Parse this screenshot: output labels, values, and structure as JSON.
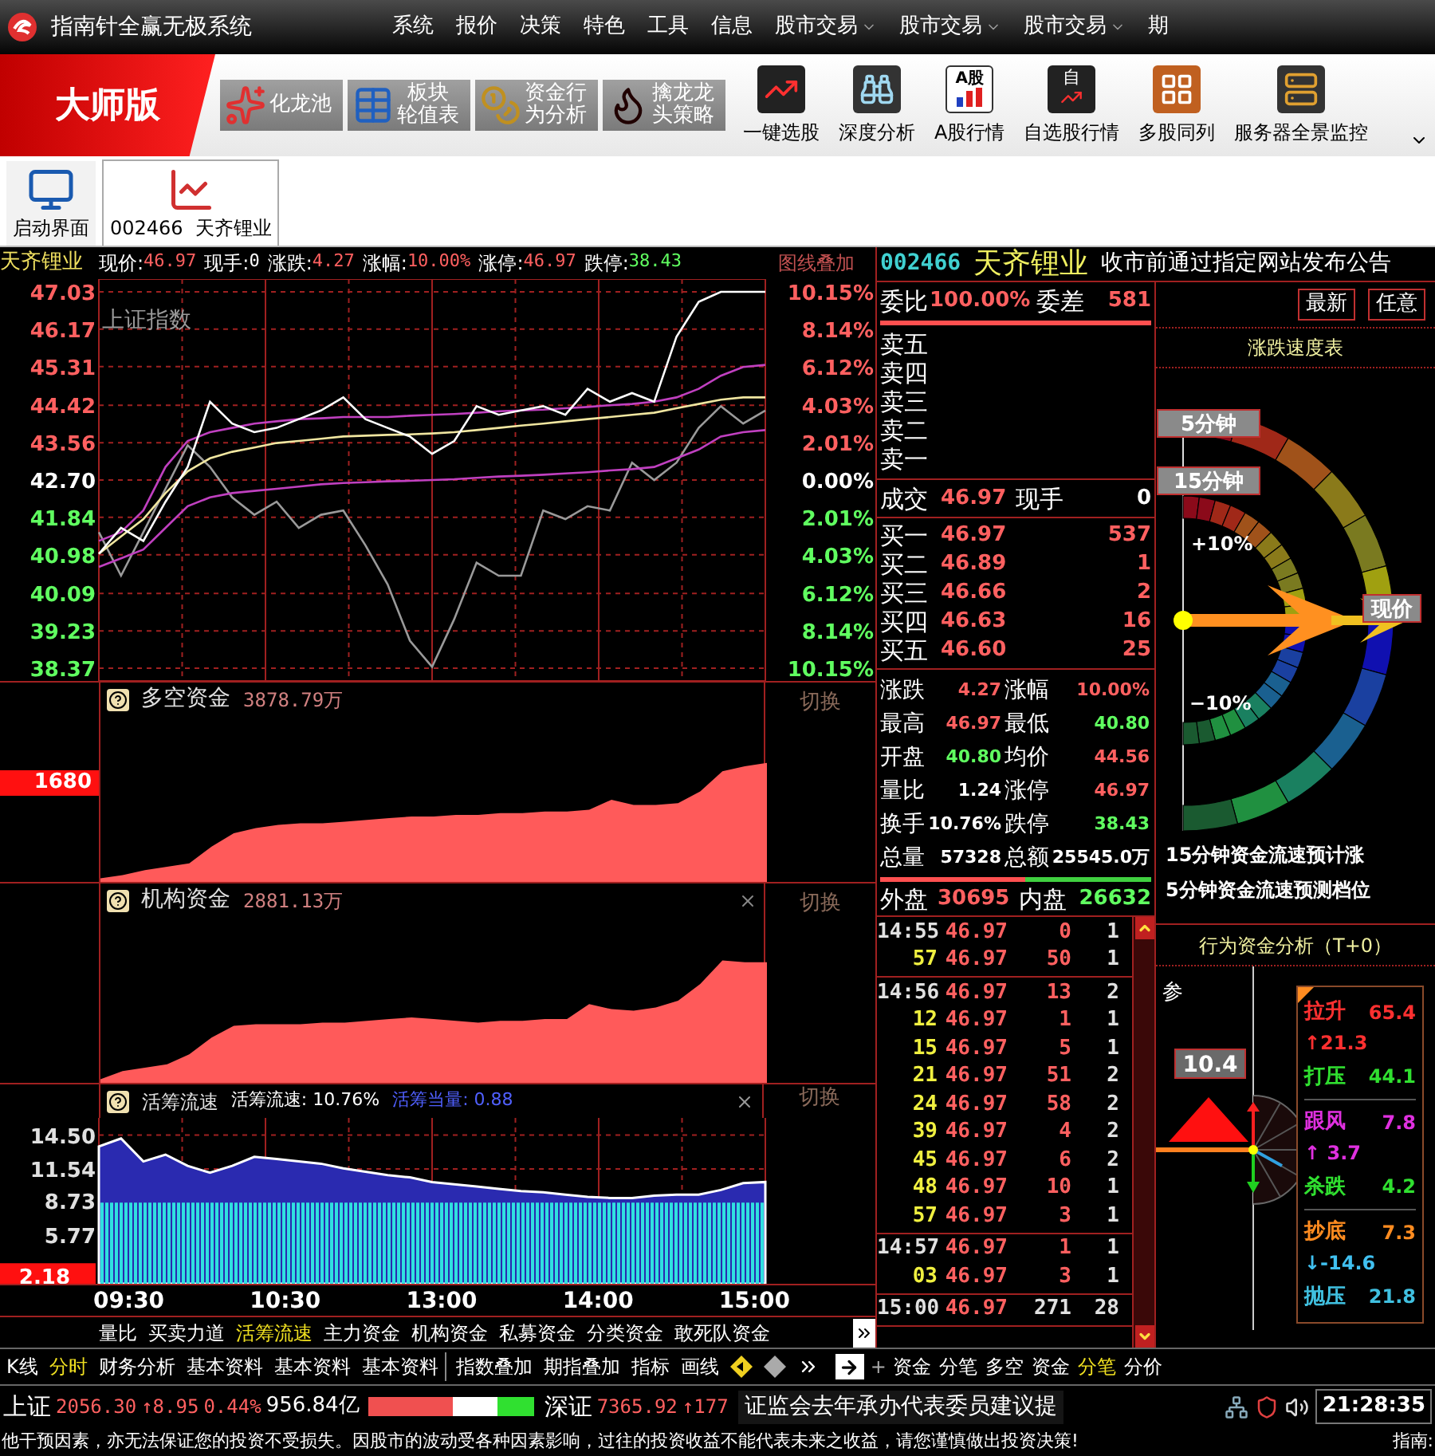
{
  "title_bar": {
    "app_name": "指南针全赢无极系统",
    "menu": [
      {
        "label": "系统",
        "has_dropdown": false
      },
      {
        "label": "报价",
        "has_dropdown": false
      },
      {
        "label": "决策",
        "has_dropdown": false
      },
      {
        "label": "特色",
        "has_dropdown": false
      },
      {
        "label": "工具",
        "has_dropdown": false
      },
      {
        "label": "信息",
        "has_dropdown": false
      },
      {
        "label": "股市交易",
        "has_dropdown": true
      },
      {
        "label": "股市交易",
        "has_dropdown": true
      },
      {
        "label": "股市交易",
        "has_dropdown": true
      },
      {
        "label": "期",
        "has_dropdown": false
      }
    ]
  },
  "toolbar": {
    "edition": "大师版",
    "feature_buttons": [
      {
        "kind": "swirl",
        "lines": [
          "化龙池"
        ]
      },
      {
        "kind": "table",
        "lines": [
          "板块",
          "轮值表"
        ]
      },
      {
        "kind": "coins",
        "lines": [
          "资金行",
          "为分析"
        ]
      },
      {
        "kind": "dragon",
        "lines": [
          "擒龙龙",
          "头策略"
        ]
      }
    ],
    "icon_buttons": [
      {
        "kind": "trend",
        "label": "一键选股"
      },
      {
        "kind": "binoculars",
        "label": "深度分析"
      },
      {
        "kind": "bars",
        "label": "A股行情",
        "icon_text": "A股"
      },
      {
        "kind": "check",
        "label": "自选股行情",
        "icon_text": "自"
      },
      {
        "kind": "grid",
        "label": "多股同列"
      },
      {
        "kind": "server",
        "label": "服务器全景监控"
      }
    ]
  },
  "tabs": [
    {
      "kind": "monitor",
      "label": "启动界面",
      "selected": false
    },
    {
      "kind": "chart",
      "label": "002466  天齐锂业",
      "selected": true
    }
  ],
  "price_chart": {
    "stock_name": "天齐锂业",
    "quote_fields": [
      {
        "label": "现价:",
        "value": "46.97",
        "color": "#ff6060"
      },
      {
        "label": "现手:",
        "value": "0",
        "color": "#ffffff"
      },
      {
        "label": "涨跌:",
        "value": "4.27",
        "color": "#ff6060"
      },
      {
        "label": "涨幅:",
        "value": "10.00%",
        "color": "#ff6060"
      },
      {
        "label": "涨停:",
        "value": "46.97",
        "color": "#ff6060"
      },
      {
        "label": "跌停:",
        "value": "38.43",
        "color": "#60ff60"
      }
    ],
    "overlay_button": "图线叠加",
    "right_axis": [
      {
        "label": "10.15%",
        "color": "#ff6060"
      },
      {
        "label": "8.14%",
        "color": "#ff6060"
      },
      {
        "label": "6.12%",
        "color": "#ff6060"
      },
      {
        "label": "4.03%",
        "color": "#ff6060"
      },
      {
        "label": "2.01%",
        "color": "#ff6060"
      },
      {
        "label": "0.00%",
        "color": "#ffffff"
      },
      {
        "label": "2.01%",
        "color": "#60ff60"
      },
      {
        "label": "4.03%",
        "color": "#60ff60"
      },
      {
        "label": "6.12%",
        "color": "#60ff60"
      },
      {
        "label": "8.14%",
        "color": "#60ff60"
      },
      {
        "label": "10.15%",
        "color": "#60ff60"
      }
    ],
    "chart_data": {
      "type": "line",
      "grid": true,
      "ylim": [
        38.37,
        47.03
      ],
      "yticks": [
        {
          "value": 47.03,
          "label": "47.03"
        },
        {
          "value": 46.17,
          "label": "46.17"
        },
        {
          "value": 45.31,
          "label": "45.31"
        },
        {
          "value": 44.42,
          "label": "44.42"
        },
        {
          "value": 43.56,
          "label": "43.56"
        },
        {
          "value": 42.7,
          "label": "42.70"
        },
        {
          "value": 41.84,
          "label": "41.84"
        },
        {
          "value": 40.98,
          "label": "40.98"
        },
        {
          "value": 40.09,
          "label": "40.09"
        },
        {
          "value": 39.23,
          "label": "39.23"
        },
        {
          "value": 38.37,
          "label": "38.37"
        }
      ],
      "series": [
        {
          "name": "上证指数",
          "color": "#9a9a9a",
          "values": [
            41.5,
            40.5,
            41.5,
            42.5,
            43.5,
            43.0,
            42.3,
            41.9,
            42.2,
            41.6,
            41.9,
            42.0,
            41.2,
            40.3,
            39.0,
            38.4,
            39.5,
            40.8,
            40.5,
            40.5,
            42.0,
            41.8,
            42.1,
            42.0,
            43.1,
            42.7,
            43.1,
            43.9,
            44.4,
            44.0,
            44.3
          ]
        },
        {
          "color": "#c040c0",
          "values": [
            41.3,
            41.5,
            42.0,
            43.0,
            43.6,
            43.8,
            43.9,
            44.0,
            44.05,
            44.1,
            44.12,
            44.15,
            44.15,
            44.15,
            44.18,
            44.2,
            44.22,
            44.25,
            44.28,
            44.3,
            44.32,
            44.35,
            44.38,
            44.42,
            44.45,
            44.5,
            44.6,
            44.8,
            45.1,
            45.3,
            45.35
          ]
        },
        {
          "color": "#c040c0",
          "values": [
            40.7,
            40.9,
            41.1,
            41.6,
            42.1,
            42.3,
            42.4,
            42.45,
            42.5,
            42.55,
            42.6,
            42.63,
            42.65,
            42.67,
            42.68,
            42.7,
            42.72,
            42.75,
            42.78,
            42.8,
            42.82,
            42.85,
            42.88,
            42.92,
            42.95,
            43.0,
            43.2,
            43.4,
            43.7,
            43.8,
            43.85
          ]
        },
        {
          "color": "#f0e6a0",
          "values": [
            41.0,
            41.4,
            41.8,
            42.4,
            42.9,
            43.2,
            43.35,
            43.45,
            43.55,
            43.6,
            43.65,
            43.7,
            43.72,
            43.74,
            43.75,
            43.77,
            43.8,
            43.85,
            43.9,
            43.95,
            44.0,
            44.05,
            44.1,
            44.15,
            44.2,
            44.25,
            44.35,
            44.45,
            44.55,
            44.6,
            44.6
          ]
        },
        {
          "color": "#ffffff",
          "values": [
            41.0,
            41.6,
            41.3,
            42.2,
            43.0,
            44.5,
            44.0,
            43.8,
            43.9,
            44.1,
            44.3,
            44.6,
            44.1,
            43.9,
            43.7,
            43.3,
            43.6,
            44.4,
            44.2,
            44.3,
            44.4,
            44.2,
            44.8,
            44.5,
            44.7,
            44.5,
            46.0,
            46.8,
            47.03,
            47.03,
            47.03
          ]
        }
      ]
    }
  },
  "fund_panels": [
    {
      "title": "多空资金",
      "value": "3878.79万",
      "marker": "1680",
      "closable": false,
      "switch_label": "切换"
    },
    {
      "title": "机构资金",
      "value": "2881.13万",
      "closable": true,
      "switch_label": "切换"
    }
  ],
  "flow_panel": {
    "title": "活筹流速",
    "stat_label": "活筹流速:",
    "stat_value": "10.76%",
    "equiv_label": "活筹当量:",
    "equiv_value": "0.88",
    "closable": true,
    "switch_label": "切换",
    "marker": "2.18",
    "chart_data": {
      "type": "area",
      "grid": true,
      "ylim": [
        1.5,
        16.0
      ],
      "yticks": [
        {
          "value": 14.5,
          "label": "14.50"
        },
        {
          "value": 11.54,
          "label": "11.54"
        },
        {
          "value": 8.73,
          "label": "8.73"
        },
        {
          "value": 5.77,
          "label": "5.77"
        }
      ],
      "series": [
        {
          "color": "#2a2ab0",
          "values": [
            13.5,
            14.2,
            12.2,
            12.8,
            11.8,
            11.2,
            11.8,
            12.6,
            12.4,
            12.2,
            12.0,
            11.6,
            11.3,
            11.0,
            10.8,
            10.4,
            10.2,
            10.0,
            9.8,
            9.6,
            9.5,
            9.3,
            9.1,
            9.0,
            9.0,
            9.2,
            9.3,
            9.3,
            9.7,
            10.3,
            10.4
          ]
        },
        {
          "color": "#30e0e0",
          "values": [
            8.6,
            8.6,
            8.6,
            8.6,
            8.6,
            8.6,
            8.6,
            8.6,
            8.6,
            8.6,
            8.6,
            8.6,
            8.6,
            8.6,
            8.6,
            8.6,
            8.6,
            8.6,
            8.6,
            8.6,
            8.6,
            8.6,
            8.6,
            8.6,
            8.6,
            8.6,
            8.6,
            8.6,
            8.6,
            8.6,
            8.6
          ]
        }
      ]
    }
  },
  "time_axis": [
    "09:30",
    "10:30",
    "13:00",
    "14:00",
    "15:00"
  ],
  "indicator_tabs": [
    {
      "label": "量比",
      "selected": false
    },
    {
      "label": "买卖力道",
      "selected": false
    },
    {
      "label": "活筹流速",
      "selected": true
    },
    {
      "label": "主力资金",
      "selected": false
    },
    {
      "label": "机构资金",
      "selected": false
    },
    {
      "label": "私募资金",
      "selected": false
    },
    {
      "label": "分类资金",
      "selected": false
    },
    {
      "label": "敢死队资金",
      "selected": false
    }
  ],
  "quote": {
    "code": "002466",
    "name": "天齐锂业",
    "notice": "收市前通过指定网站发布公告",
    "order_ratio": {
      "label": "委比",
      "value": "100.00%",
      "diff_label": "委差",
      "diff_value": "581",
      "level": 1
    },
    "sells": [
      "卖五",
      "卖四",
      "卖三",
      "卖二",
      "卖一"
    ],
    "last": {
      "label": "成交",
      "price": "46.97",
      "hand_label": "现手",
      "hand": "0"
    },
    "buys": [
      {
        "label": "买一",
        "price": "46.97",
        "volume": "537"
      },
      {
        "label": "买二",
        "price": "46.89",
        "volume": "1"
      },
      {
        "label": "买三",
        "price": "46.66",
        "volume": "2"
      },
      {
        "label": "买四",
        "price": "46.63",
        "volume": "16"
      },
      {
        "label": "买五",
        "price": "46.60",
        "volume": "25"
      }
    ],
    "stats": [
      {
        "label": "涨跌",
        "value": "4.27",
        "color": "#ff6060"
      },
      {
        "label": "涨幅",
        "value": "10.00%",
        "color": "#ff6060"
      },
      {
        "label": "最高",
        "value": "46.97",
        "color": "#ff6060"
      },
      {
        "label": "最低",
        "value": "40.80",
        "color": "#60ff60"
      },
      {
        "label": "开盘",
        "value": "40.80",
        "color": "#60ff60"
      },
      {
        "label": "均价",
        "value": "44.56",
        "color": "#ff6060"
      },
      {
        "label": "量比",
        "value": "1.24",
        "color": "#ffffff"
      },
      {
        "label": "涨停",
        "value": "46.97",
        "color": "#ff6060"
      },
      {
        "label": "换手",
        "value": "10.76%",
        "color": "#ffffff"
      },
      {
        "label": "跌停",
        "value": "38.43",
        "color": "#60ff60"
      },
      {
        "label": "总量",
        "value": "57328",
        "color": "#ffffff"
      },
      {
        "label": "总额",
        "value": "25545.0万",
        "color": "#ffffff"
      }
    ],
    "outer": {
      "label": "外盘",
      "value": "30695",
      "inner_label": "内盘",
      "inner_value": "26632",
      "level": 0.535
    }
  },
  "trades": [
    {
      "rows": [
        {
          "time": "14:55",
          "price": "46.97",
          "volume": "0",
          "count": "1",
          "kind": "buy"
        },
        {
          "time": "57",
          "price": "46.97",
          "volume": "50",
          "count": "1",
          "kind": "buy"
        }
      ]
    },
    {
      "rows": [
        {
          "time": "14:56",
          "price": "46.97",
          "volume": "13",
          "count": "2",
          "kind": "buy"
        },
        {
          "time": "12",
          "price": "46.97",
          "volume": "1",
          "count": "1",
          "kind": "buy"
        },
        {
          "time": "15",
          "price": "46.97",
          "volume": "5",
          "count": "1",
          "kind": "buy"
        },
        {
          "time": "21",
          "price": "46.97",
          "volume": "51",
          "count": "2",
          "kind": "buy"
        },
        {
          "time": "24",
          "price": "46.97",
          "volume": "58",
          "count": "2",
          "kind": "buy"
        },
        {
          "time": "39",
          "price": "46.97",
          "volume": "4",
          "count": "2",
          "kind": "buy"
        },
        {
          "time": "45",
          "price": "46.97",
          "volume": "6",
          "count": "2",
          "kind": "buy"
        },
        {
          "time": "48",
          "price": "46.97",
          "volume": "10",
          "count": "1",
          "kind": "buy"
        },
        {
          "time": "57",
          "price": "46.97",
          "volume": "3",
          "count": "1",
          "kind": "buy"
        }
      ]
    },
    {
      "rows": [
        {
          "time": "14:57",
          "price": "46.97",
          "volume": "1",
          "count": "1",
          "kind": "buy"
        },
        {
          "time": "03",
          "price": "46.97",
          "volume": "3",
          "count": "1",
          "kind": "buy"
        }
      ]
    },
    {
      "rows": [
        {
          "time": "15:00",
          "price": "46.97",
          "volume": "271",
          "count": "28",
          "kind": "neutral"
        }
      ]
    }
  ],
  "speed_gauge": {
    "buttons": [
      "最新",
      "任意"
    ],
    "title": "涨跌速度表",
    "five_label": "5分钟",
    "fifteen_label": "15分钟",
    "plus_label": "+10%",
    "minus_label": "−10%",
    "price_label": "现价",
    "notes": [
      "15分钟资金流速预计涨",
      "5分钟资金流速预测档位"
    ]
  },
  "behavior": {
    "title": "行为资金分析（T+0）",
    "ref_label": "参",
    "reading": "10.4",
    "legend": [
      {
        "items": [
          {
            "label": "拉升",
            "value": "65.4",
            "color": "#ff3030",
            "sub": {
              "text": "↑21.3",
              "color": "#ff3030"
            }
          },
          {
            "label": "打压",
            "value": "44.1",
            "color": "#30e030"
          }
        ]
      },
      {
        "items": [
          {
            "label": "跟风",
            "value": "7.8",
            "color": "#e030e0",
            "sub": {
              "text": "↑ 3.7",
              "color": "#e030e0"
            }
          },
          {
            "label": "杀跌",
            "value": "4.2",
            "color": "#30e030"
          }
        ]
      },
      {
        "items": [
          {
            "label": "抄底",
            "value": "7.3",
            "color": "#ff8c20",
            "sub": {
              "text": "↓-14.6",
              "color": "#40c0f0"
            }
          },
          {
            "label": "抛压",
            "value": "21.8",
            "color": "#40c0e0"
          }
        ]
      }
    ]
  },
  "bottom_toolbar": {
    "left": [
      {
        "label": "K线",
        "selected": false
      },
      {
        "label": "分时",
        "selected": true
      },
      {
        "label": "财务分析",
        "selected": false
      },
      {
        "label": "基本资料",
        "selected": false
      },
      {
        "label": "基本资料",
        "selected": false
      },
      {
        "label": "基本资料",
        "selected": false
      }
    ],
    "middle": [
      "指数叠加",
      "期指叠加",
      "指标",
      "画线"
    ],
    "right_prefix": "+",
    "right": [
      {
        "label": "资金",
        "selected": false
      },
      {
        "label": "分笔",
        "selected": false
      },
      {
        "label": "多空",
        "selected": false
      },
      {
        "label": "资金",
        "selected": false
      },
      {
        "label": "分笔",
        "selected": true
      },
      {
        "label": "分价",
        "selected": false
      }
    ]
  },
  "status_bar": {
    "markets": [
      {
        "label": "上证",
        "index": "2056.30",
        "change": "↑8.95",
        "pct": "0.44%",
        "amount": "956.84亿",
        "color": "#ff6060"
      },
      {
        "label": "深证",
        "index": "7365.92",
        "change": "↑177",
        "color": "#ff6060"
      }
    ],
    "breadth": {
      "up": {
        "level": 0.51
      },
      "down": {
        "level": 0.22
      }
    },
    "ticker": "证监会去年承办代表委员建议提",
    "clock": "21:28:35"
  },
  "disclaimer": {
    "text": "他干预因素，亦无法保证您的投资不受损失。因股市的波动受各种因素影响，过往的投资收益不能代表未来之收益，请您谨慎做出投资决策!",
    "right_label": "指南:"
  }
}
